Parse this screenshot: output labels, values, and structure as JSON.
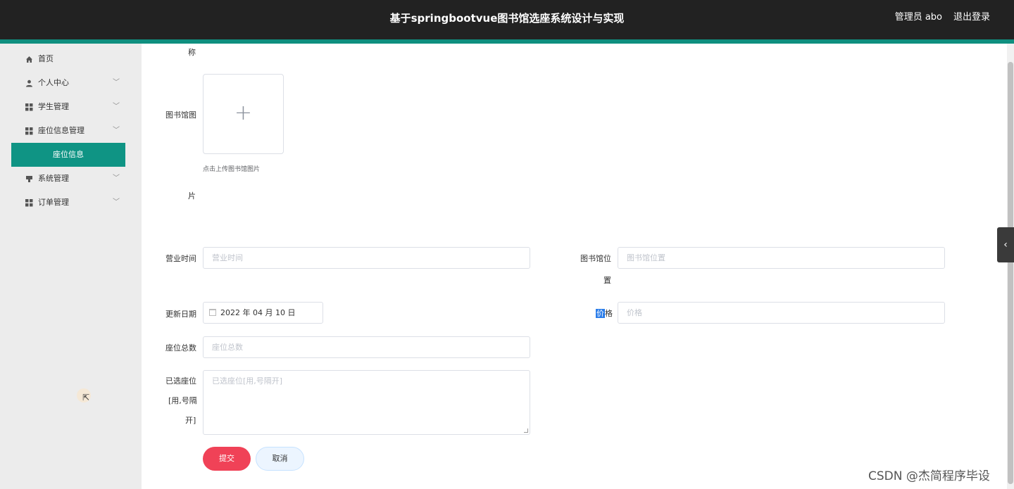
{
  "header": {
    "title": "基于springbootvue图书馆选座系统设计与实现",
    "user": "管理员 abo",
    "logout": "退出登录"
  },
  "sidebar": {
    "items": [
      {
        "label": "首页",
        "icon": "home-icon"
      },
      {
        "label": "个人中心",
        "icon": "user-icon"
      },
      {
        "label": "学生管理",
        "icon": "grid-icon"
      },
      {
        "label": "座位信息管理",
        "icon": "grid-icon"
      },
      {
        "label": "座位信息",
        "icon": ""
      },
      {
        "label": "系统管理",
        "icon": "settings-icon"
      },
      {
        "label": "订单管理",
        "icon": "grid-icon"
      }
    ]
  },
  "form": {
    "name_label_tail": "称",
    "image_label_a": "图书馆图",
    "image_label_b": "片",
    "upload_hint": "点击上传图书馆图片",
    "hours": {
      "label": "营业时间",
      "placeholder": "营业时间"
    },
    "location": {
      "label_a": "图书馆位",
      "label_b": "置",
      "placeholder": "图书馆位置"
    },
    "update_date": {
      "label": "更新日期",
      "value": "2022 年 04 月 10 日"
    },
    "price": {
      "label_hl": "价",
      "label_rest": "格",
      "placeholder": "价格"
    },
    "seat_total": {
      "label": "座位总数",
      "placeholder": "座位总数"
    },
    "selected_seats": {
      "label_a": "已选座位",
      "label_b": "[用,号隔",
      "label_c": "开]",
      "placeholder": "已选座位[用,号隔开]"
    },
    "submit": "提交",
    "cancel": "取消"
  },
  "watermark": "CSDN @杰简程序毕设"
}
